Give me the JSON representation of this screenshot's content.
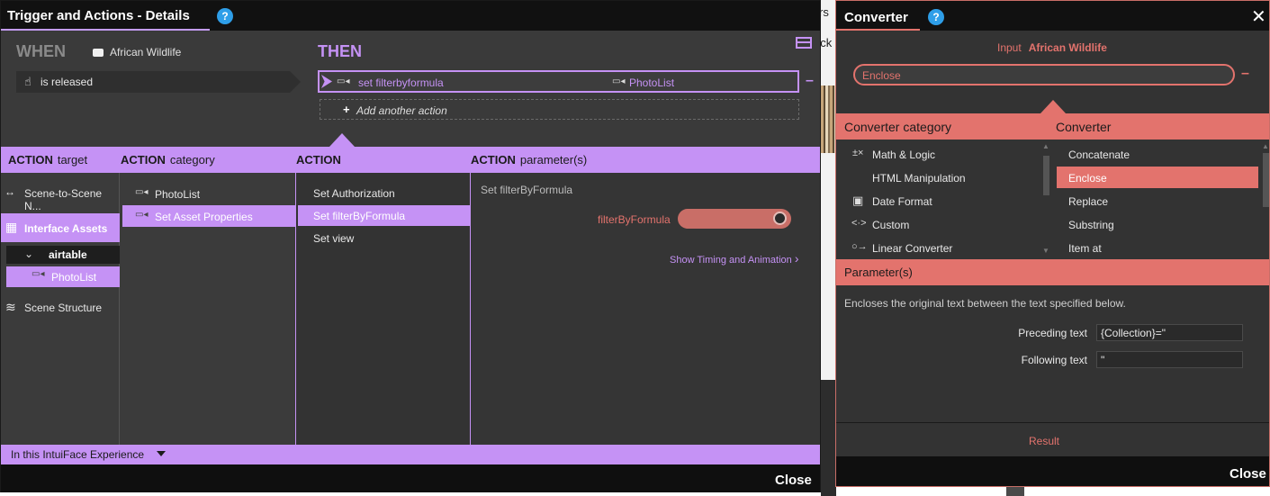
{
  "background": {
    "fragments": [
      "rs",
      "ack"
    ]
  },
  "trigger_window": {
    "title": "Trigger and Actions - Details",
    "help_icon": "?",
    "when_label": "WHEN",
    "when_source": "African Wildlife",
    "trigger_text": "is released",
    "then_label": "THEN",
    "action_name": "set filterbyformula",
    "action_target": "PhotoList",
    "add_action_label": "Add another action",
    "columns": {
      "target": {
        "bold": "ACTION",
        "rest": "target"
      },
      "category": {
        "bold": "ACTION",
        "rest": "category"
      },
      "action": {
        "bold": "ACTION",
        "rest": ""
      },
      "params": {
        "bold": "ACTION",
        "rest": "parameter(s)"
      }
    },
    "target_items": {
      "scene_nav": "Scene-to-Scene N...",
      "interface_assets": "Interface Assets",
      "airtable": "airtable",
      "photolist": "PhotoList",
      "scene_structure": "Scene Structure"
    },
    "category_items": [
      "PhotoList",
      "Set Asset Properties"
    ],
    "action_items": [
      "Set Authorization",
      "Set filterByFormula",
      "Set view"
    ],
    "param_title": "Set filterByFormula",
    "param_field_label": "filterByFormula",
    "timing_link": "Show Timing and Animation",
    "scope_label": "In this IntuiFace Experience",
    "close_label": "Close",
    "accent_color": "#c592f5"
  },
  "converter_window": {
    "title": "Converter",
    "help_icon": "?",
    "input_label": "Input",
    "input_value": "African Wildlife",
    "selected_converter_field": "Enclose",
    "category_header": "Converter category",
    "converter_header": "Converter",
    "categories": [
      {
        "label": "Math & Logic",
        "icon": "math-icon"
      },
      {
        "label": "HTML Manipulation",
        "icon": ""
      },
      {
        "label": "Date Format",
        "icon": "calendar-icon"
      },
      {
        "label": "Custom",
        "icon": "custom-icon"
      },
      {
        "label": "Linear Converter",
        "icon": "linear-icon"
      }
    ],
    "converters": [
      "Concatenate",
      "Enclose",
      "Replace",
      "Substring",
      "Item at"
    ],
    "selected_converter": "Enclose",
    "params_header": "Parameter(s)",
    "description": "Encloses the original text between the text specified below.",
    "preceding_label": "Preceding text",
    "preceding_value": "{Collection}=\"",
    "following_label": "Following text",
    "following_value": "\"",
    "result_label": "Result",
    "close_label": "Close",
    "accent_color": "#e3736d"
  }
}
